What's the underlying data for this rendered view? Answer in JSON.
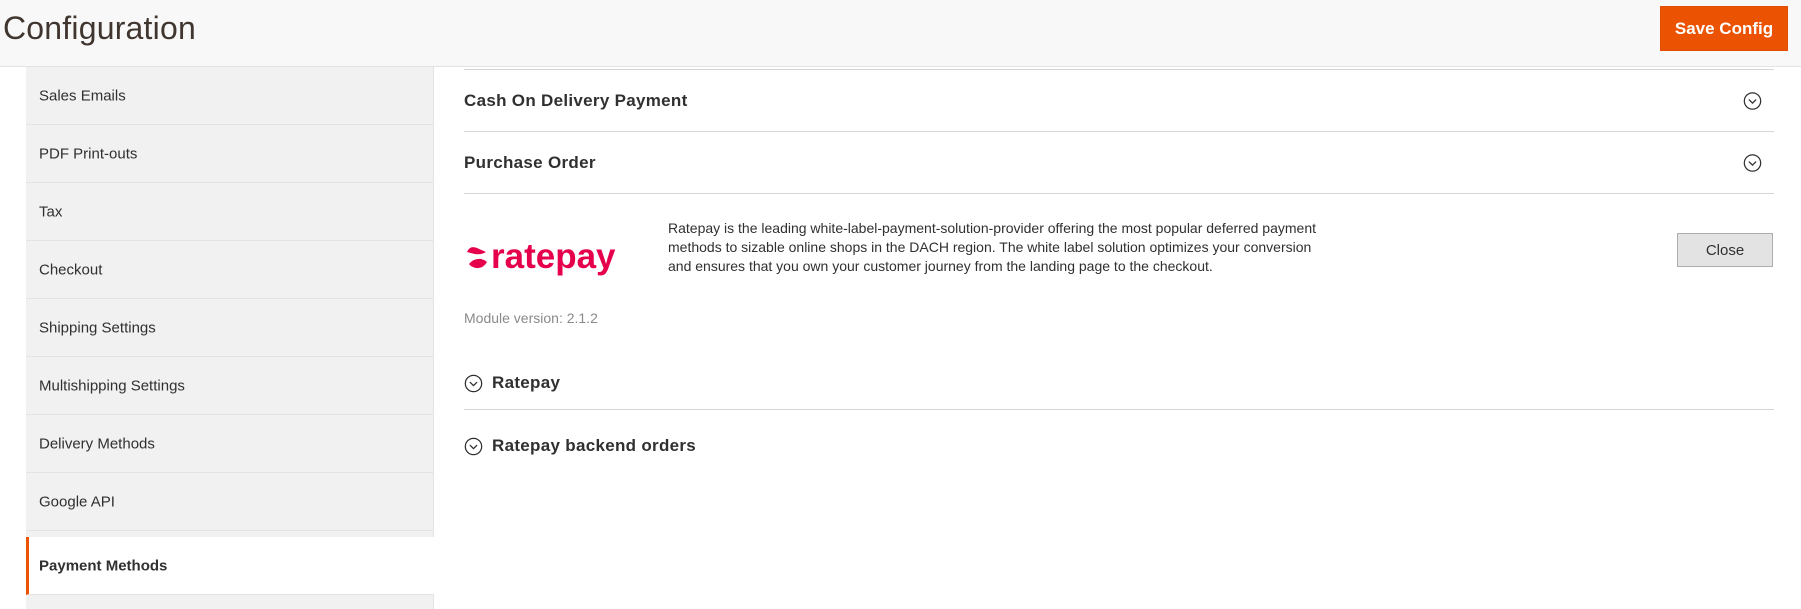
{
  "header": {
    "title": "Configuration",
    "save_label": "Save Config",
    "accent_color": "#eb5202"
  },
  "sidebar": {
    "items": [
      {
        "label": "Sales Emails"
      },
      {
        "label": "PDF Print-outs"
      },
      {
        "label": "Tax"
      },
      {
        "label": "Checkout"
      },
      {
        "label": "Shipping Settings"
      },
      {
        "label": "Multishipping Settings"
      },
      {
        "label": "Delivery Methods"
      },
      {
        "label": "Google API"
      },
      {
        "label": "Payment Methods",
        "active": true
      }
    ]
  },
  "main": {
    "sections": [
      {
        "title": "Cash On Delivery Payment",
        "icon": "chevron-down-circle-icon"
      },
      {
        "title": "Purchase Order",
        "icon": "chevron-down-circle-icon"
      }
    ],
    "ratepay": {
      "logo_text": "ratepay",
      "brand_color": "#e6004c",
      "description": "Ratepay is the leading white-label-payment-solution-provider offering the most popular deferred payment methods to sizable online shops in the DACH region. The white label solution optimizes your conversion and ensures that you own your customer journey from the landing page to the checkout.",
      "close_label": "Close",
      "module_version": "Module version: 2.1.2",
      "groups": [
        {
          "title": "Ratepay",
          "icon": "chevron-down-circle-icon"
        },
        {
          "title": "Ratepay backend orders",
          "icon": "chevron-down-circle-icon"
        }
      ]
    }
  }
}
